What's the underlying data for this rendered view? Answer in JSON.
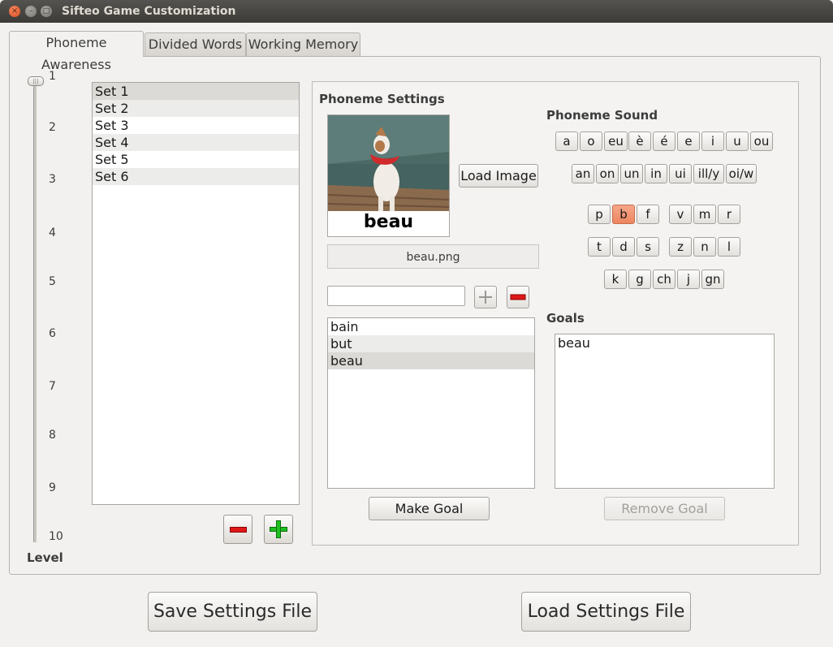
{
  "window": {
    "title": "Sifteo Game Customization"
  },
  "tabs": [
    {
      "label": "Phoneme Awareness"
    },
    {
      "label": "Divided Words"
    },
    {
      "label": "Working Memory"
    }
  ],
  "level_slider": {
    "label": "Level",
    "ticks": [
      "1",
      "2",
      "3",
      "4",
      "5",
      "6",
      "7",
      "8",
      "9",
      "10"
    ],
    "value": 1
  },
  "sets": {
    "items": [
      "Set 1",
      "Set 2",
      "Set 3",
      "Set 4",
      "Set 5",
      "Set 6"
    ],
    "selected": "Set 1"
  },
  "phoneme_settings": {
    "title": "Phoneme Settings",
    "image_caption": "beau",
    "load_image_label": "Load Image",
    "filename": "beau.png",
    "word_input_value": "",
    "words": [
      "bain",
      "but",
      "beau"
    ],
    "selected_word": "beau",
    "make_goal_label": "Make Goal"
  },
  "phoneme_sound": {
    "title": "Phoneme Sound",
    "selected": "b",
    "row1": [
      "a",
      "o",
      "eu",
      "è",
      "é",
      "e",
      "i",
      "u",
      "ou"
    ],
    "row2": [
      "an",
      "on",
      "un",
      "in",
      "ui",
      "ill/y",
      "oi/w"
    ],
    "row3a": [
      "p",
      "b",
      "f"
    ],
    "row3b": [
      "v",
      "m",
      "r"
    ],
    "row4a": [
      "t",
      "d",
      "s"
    ],
    "row4b": [
      "z",
      "n",
      "l"
    ],
    "row5": [
      "k",
      "g",
      "ch",
      "j",
      "gn"
    ]
  },
  "goals": {
    "title": "Goals",
    "items": [
      "beau"
    ],
    "remove_goal_label": "Remove Goal"
  },
  "footer": {
    "save_label": "Save Settings File",
    "load_label": "Load Settings File"
  },
  "colors": {
    "selected_phoneme": "#ec8660",
    "remove_icon": "#e01818",
    "add_icon": "#1fbf1f"
  }
}
